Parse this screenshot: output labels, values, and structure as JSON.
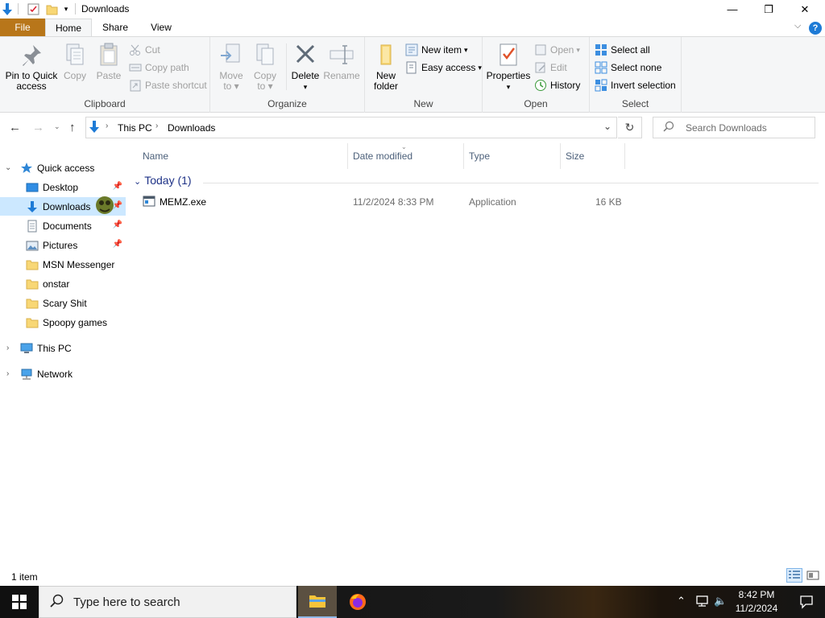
{
  "window": {
    "title": "Downloads",
    "minimize_glyph": "—",
    "restore_glyph": "❐",
    "close_glyph": "✕"
  },
  "tabs": [
    "File",
    "Home",
    "Share",
    "View"
  ],
  "ribbon": {
    "clipboard": {
      "label": "Clipboard",
      "pin": "Pin to Quick\naccess",
      "pin_line1": "Pin to Quick",
      "pin_line2": "access",
      "copy": "Copy",
      "paste": "Paste",
      "cut": "Cut",
      "copy_path": "Copy path",
      "paste_shortcut": "Paste shortcut"
    },
    "organize": {
      "label": "Organize",
      "move_line1": "Move",
      "move_line2": "to",
      "copy_line1": "Copy",
      "copy_line2": "to",
      "delete": "Delete",
      "rename": "Rename"
    },
    "new": {
      "label": "New",
      "new_folder_line1": "New",
      "new_folder_line2": "folder",
      "new_item": "New item",
      "easy_access": "Easy access"
    },
    "open": {
      "label": "Open",
      "properties": "Properties",
      "open": "Open",
      "edit": "Edit",
      "history": "History"
    },
    "select": {
      "label": "Select",
      "select_all": "Select all",
      "select_none": "Select none",
      "invert_selection": "Invert selection"
    }
  },
  "breadcrumb": [
    "This PC",
    "Downloads"
  ],
  "search": {
    "placeholder": "Search Downloads"
  },
  "nav": {
    "quick_access": "Quick access",
    "quick_items": [
      {
        "label": "Desktop",
        "icon": "desktop-icon",
        "pinned": true
      },
      {
        "label": "Downloads",
        "icon": "download-arrow-icon",
        "pinned": true,
        "selected": true
      },
      {
        "label": "Documents",
        "icon": "document-icon",
        "pinned": true
      },
      {
        "label": "Pictures",
        "icon": "pictures-icon",
        "pinned": true
      },
      {
        "label": "MSN Messenger",
        "icon": "folder-icon",
        "pinned": false
      },
      {
        "label": "onstar",
        "icon": "folder-icon",
        "pinned": false
      },
      {
        "label": "Scary Shit",
        "icon": "folder-icon",
        "pinned": false
      },
      {
        "label": "Spoopy games",
        "icon": "folder-icon",
        "pinned": false
      }
    ],
    "this_pc": "This PC",
    "network": "Network"
  },
  "columns": [
    "Name",
    "Date modified",
    "Type",
    "Size"
  ],
  "group": {
    "label": "Today (1)"
  },
  "files": [
    {
      "name": "MEMZ.exe",
      "date_modified": "11/2/2024 8:33 PM",
      "type": "Application",
      "size": "16 KB",
      "icon": "application-icon"
    }
  ],
  "status": {
    "count": "1 item"
  },
  "taskbar": {
    "search_placeholder": "Type here to search",
    "time": "8:42 PM",
    "date": "11/2/2024"
  },
  "colors": {
    "file_tab": "#b8761a",
    "selected_nav": "#cce8ff",
    "accent_blue": "#1e7bd6",
    "folder_yellow": "#f8d775"
  }
}
